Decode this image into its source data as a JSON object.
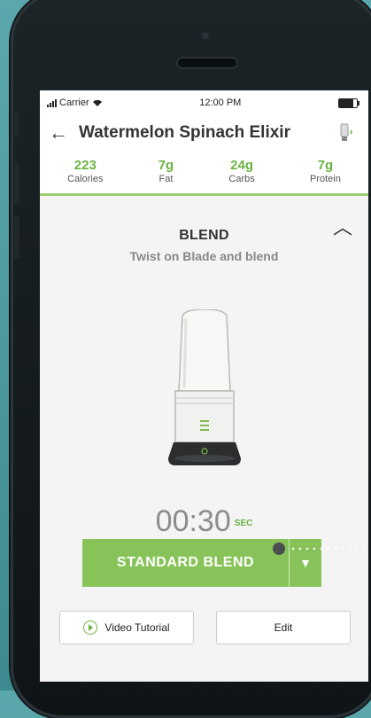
{
  "status_bar": {
    "carrier": "Carrier",
    "time": "12:00 PM"
  },
  "header": {
    "title": "Watermelon Spinach Elixir"
  },
  "nutrition": [
    {
      "value": "223",
      "label": "Calories"
    },
    {
      "value": "7g",
      "label": "Fat"
    },
    {
      "value": "24g",
      "label": "Carbs"
    },
    {
      "value": "7g",
      "label": "Protein"
    }
  ],
  "step": {
    "heading": "BLEND",
    "instruction": "Twist on Blade and blend"
  },
  "timer": {
    "value": "00:30",
    "unit": "SEC"
  },
  "blend_button": {
    "label": "STANDARD BLEND"
  },
  "actions": {
    "video_label": "Video Tutorial",
    "edit_label": "Edit"
  },
  "colors": {
    "accent": "#87c359",
    "nutrition_value": "#6bb342",
    "background": "#4f9ca2"
  }
}
